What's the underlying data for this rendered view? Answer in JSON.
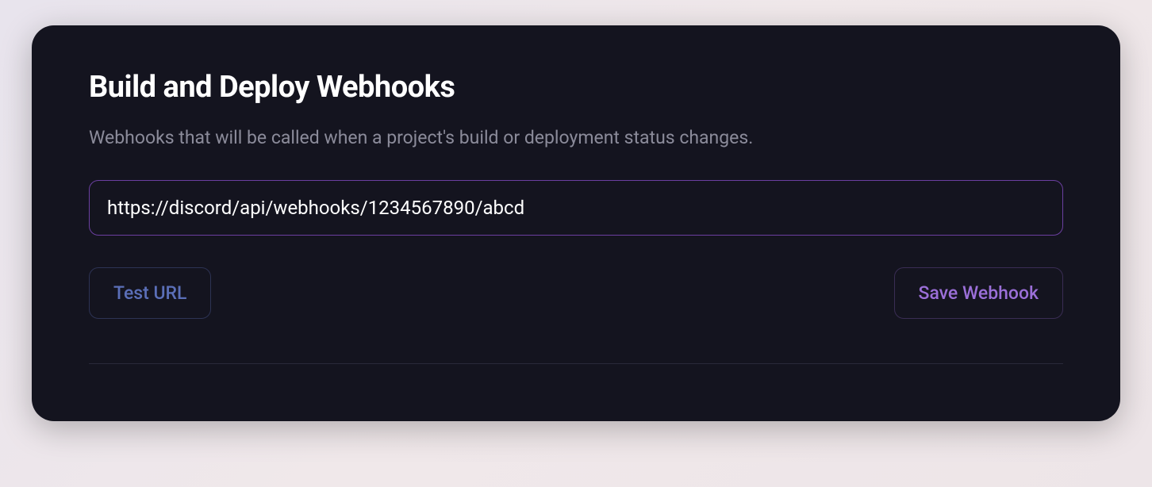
{
  "card": {
    "title": "Build and Deploy Webhooks",
    "description": "Webhooks that will be called when a project's build or deployment status changes.",
    "url_input": {
      "value": "https://discord/api/webhooks/1234567890/abcd",
      "placeholder": ""
    },
    "buttons": {
      "test_label": "Test URL",
      "save_label": "Save Webhook"
    }
  }
}
